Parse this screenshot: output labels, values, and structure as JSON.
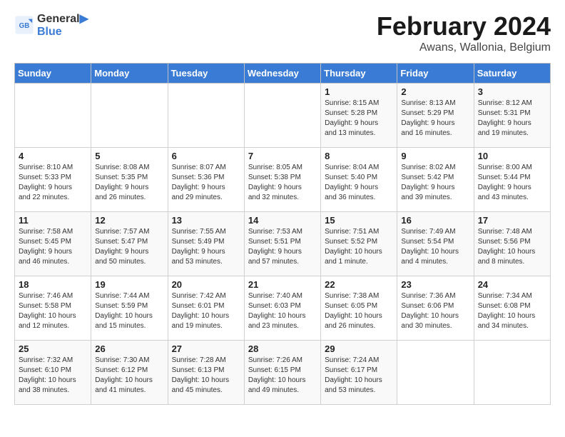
{
  "header": {
    "logo_line1": "General",
    "logo_line2": "Blue",
    "month_year": "February 2024",
    "location": "Awans, Wallonia, Belgium"
  },
  "days_of_week": [
    "Sunday",
    "Monday",
    "Tuesday",
    "Wednesday",
    "Thursday",
    "Friday",
    "Saturday"
  ],
  "weeks": [
    [
      {
        "day": "",
        "info": ""
      },
      {
        "day": "",
        "info": ""
      },
      {
        "day": "",
        "info": ""
      },
      {
        "day": "",
        "info": ""
      },
      {
        "day": "1",
        "info": "Sunrise: 8:15 AM\nSunset: 5:28 PM\nDaylight: 9 hours\nand 13 minutes."
      },
      {
        "day": "2",
        "info": "Sunrise: 8:13 AM\nSunset: 5:29 PM\nDaylight: 9 hours\nand 16 minutes."
      },
      {
        "day": "3",
        "info": "Sunrise: 8:12 AM\nSunset: 5:31 PM\nDaylight: 9 hours\nand 19 minutes."
      }
    ],
    [
      {
        "day": "4",
        "info": "Sunrise: 8:10 AM\nSunset: 5:33 PM\nDaylight: 9 hours\nand 22 minutes."
      },
      {
        "day": "5",
        "info": "Sunrise: 8:08 AM\nSunset: 5:35 PM\nDaylight: 9 hours\nand 26 minutes."
      },
      {
        "day": "6",
        "info": "Sunrise: 8:07 AM\nSunset: 5:36 PM\nDaylight: 9 hours\nand 29 minutes."
      },
      {
        "day": "7",
        "info": "Sunrise: 8:05 AM\nSunset: 5:38 PM\nDaylight: 9 hours\nand 32 minutes."
      },
      {
        "day": "8",
        "info": "Sunrise: 8:04 AM\nSunset: 5:40 PM\nDaylight: 9 hours\nand 36 minutes."
      },
      {
        "day": "9",
        "info": "Sunrise: 8:02 AM\nSunset: 5:42 PM\nDaylight: 9 hours\nand 39 minutes."
      },
      {
        "day": "10",
        "info": "Sunrise: 8:00 AM\nSunset: 5:44 PM\nDaylight: 9 hours\nand 43 minutes."
      }
    ],
    [
      {
        "day": "11",
        "info": "Sunrise: 7:58 AM\nSunset: 5:45 PM\nDaylight: 9 hours\nand 46 minutes."
      },
      {
        "day": "12",
        "info": "Sunrise: 7:57 AM\nSunset: 5:47 PM\nDaylight: 9 hours\nand 50 minutes."
      },
      {
        "day": "13",
        "info": "Sunrise: 7:55 AM\nSunset: 5:49 PM\nDaylight: 9 hours\nand 53 minutes."
      },
      {
        "day": "14",
        "info": "Sunrise: 7:53 AM\nSunset: 5:51 PM\nDaylight: 9 hours\nand 57 minutes."
      },
      {
        "day": "15",
        "info": "Sunrise: 7:51 AM\nSunset: 5:52 PM\nDaylight: 10 hours\nand 1 minute."
      },
      {
        "day": "16",
        "info": "Sunrise: 7:49 AM\nSunset: 5:54 PM\nDaylight: 10 hours\nand 4 minutes."
      },
      {
        "day": "17",
        "info": "Sunrise: 7:48 AM\nSunset: 5:56 PM\nDaylight: 10 hours\nand 8 minutes."
      }
    ],
    [
      {
        "day": "18",
        "info": "Sunrise: 7:46 AM\nSunset: 5:58 PM\nDaylight: 10 hours\nand 12 minutes."
      },
      {
        "day": "19",
        "info": "Sunrise: 7:44 AM\nSunset: 5:59 PM\nDaylight: 10 hours\nand 15 minutes."
      },
      {
        "day": "20",
        "info": "Sunrise: 7:42 AM\nSunset: 6:01 PM\nDaylight: 10 hours\nand 19 minutes."
      },
      {
        "day": "21",
        "info": "Sunrise: 7:40 AM\nSunset: 6:03 PM\nDaylight: 10 hours\nand 23 minutes."
      },
      {
        "day": "22",
        "info": "Sunrise: 7:38 AM\nSunset: 6:05 PM\nDaylight: 10 hours\nand 26 minutes."
      },
      {
        "day": "23",
        "info": "Sunrise: 7:36 AM\nSunset: 6:06 PM\nDaylight: 10 hours\nand 30 minutes."
      },
      {
        "day": "24",
        "info": "Sunrise: 7:34 AM\nSunset: 6:08 PM\nDaylight: 10 hours\nand 34 minutes."
      }
    ],
    [
      {
        "day": "25",
        "info": "Sunrise: 7:32 AM\nSunset: 6:10 PM\nDaylight: 10 hours\nand 38 minutes."
      },
      {
        "day": "26",
        "info": "Sunrise: 7:30 AM\nSunset: 6:12 PM\nDaylight: 10 hours\nand 41 minutes."
      },
      {
        "day": "27",
        "info": "Sunrise: 7:28 AM\nSunset: 6:13 PM\nDaylight: 10 hours\nand 45 minutes."
      },
      {
        "day": "28",
        "info": "Sunrise: 7:26 AM\nSunset: 6:15 PM\nDaylight: 10 hours\nand 49 minutes."
      },
      {
        "day": "29",
        "info": "Sunrise: 7:24 AM\nSunset: 6:17 PM\nDaylight: 10 hours\nand 53 minutes."
      },
      {
        "day": "",
        "info": ""
      },
      {
        "day": "",
        "info": ""
      }
    ]
  ]
}
